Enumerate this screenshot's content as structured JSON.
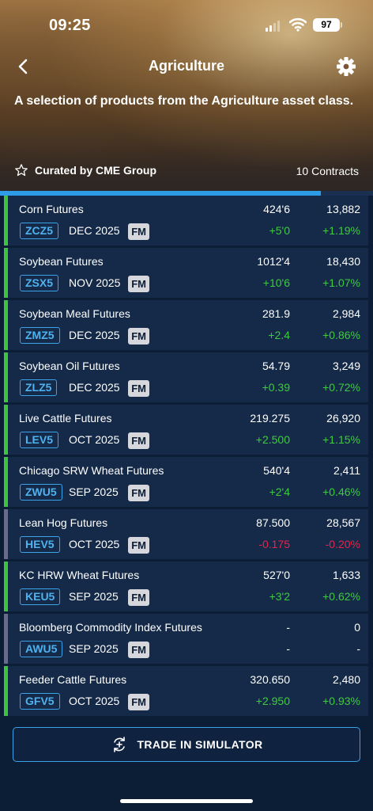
{
  "status_bar": {
    "time": "09:25",
    "battery": "97"
  },
  "header": {
    "title": "Agriculture",
    "subtitle": "A selection of products from the Agriculture asset class.",
    "curated_by": "Curated by CME Group",
    "contracts_count": "10 Contracts",
    "scroll_progress_fraction": 0.86
  },
  "colors": {
    "accent_green": "#3ec43f",
    "accent_grey": "#6b6a8a",
    "up": "#3ecb3c",
    "down": "#e8234a",
    "neutral": "#ffffff",
    "code_blue": "#3aa3e8"
  },
  "contracts": [
    {
      "name": "Corn Futures",
      "code": "ZCZ5",
      "month": "DEC 2025",
      "tag": "FM",
      "price": "424'6",
      "volume": "13,882",
      "change": "+5'0",
      "pct": "+1.19%",
      "direction": "up",
      "accent": "green"
    },
    {
      "name": "Soybean Futures",
      "code": "ZSX5",
      "month": "NOV 2025",
      "tag": "FM",
      "price": "1012'4",
      "volume": "18,430",
      "change": "+10'6",
      "pct": "+1.07%",
      "direction": "up",
      "accent": "green"
    },
    {
      "name": "Soybean Meal Futures",
      "code": "ZMZ5",
      "month": "DEC 2025",
      "tag": "FM",
      "price": "281.9",
      "volume": "2,984",
      "change": "+2.4",
      "pct": "+0.86%",
      "direction": "up",
      "accent": "green"
    },
    {
      "name": "Soybean Oil Futures",
      "code": "ZLZ5",
      "month": "DEC 2025",
      "tag": "FM",
      "price": "54.79",
      "volume": "3,249",
      "change": "+0.39",
      "pct": "+0.72%",
      "direction": "up",
      "accent": "green"
    },
    {
      "name": "Live Cattle Futures",
      "code": "LEV5",
      "month": "OCT 2025",
      "tag": "FM",
      "price": "219.275",
      "volume": "26,920",
      "change": "+2.500",
      "pct": "+1.15%",
      "direction": "up",
      "accent": "green"
    },
    {
      "name": "Chicago SRW Wheat Futures",
      "code": "ZWU5",
      "month": "SEP 2025",
      "tag": "FM",
      "price": "540'4",
      "volume": "2,411",
      "change": "+2'4",
      "pct": "+0.46%",
      "direction": "up",
      "accent": "green"
    },
    {
      "name": "Lean Hog Futures",
      "code": "HEV5",
      "month": "OCT 2025",
      "tag": "FM",
      "price": "87.500",
      "volume": "28,567",
      "change": "-0.175",
      "pct": "-0.20%",
      "direction": "down",
      "accent": "grey"
    },
    {
      "name": "KC HRW Wheat Futures",
      "code": "KEU5",
      "month": "SEP 2025",
      "tag": "FM",
      "price": "527'0",
      "volume": "1,633",
      "change": "+3'2",
      "pct": "+0.62%",
      "direction": "up",
      "accent": "green"
    },
    {
      "name": "Bloomberg Commodity Index Futures",
      "code": "AWU5",
      "month": "SEP 2025",
      "tag": "FM",
      "price": "-",
      "volume": "0",
      "change": "-",
      "pct": "-",
      "direction": "neutral",
      "accent": "grey"
    },
    {
      "name": "Feeder Cattle Futures",
      "code": "GFV5",
      "month": "OCT 2025",
      "tag": "FM",
      "price": "320.650",
      "volume": "2,480",
      "change": "+2.950",
      "pct": "+0.93%",
      "direction": "up",
      "accent": "green"
    }
  ],
  "actions": {
    "trade_button": "TRADE IN SIMULATOR"
  },
  "icons": {
    "back": "chevron-left-icon",
    "settings": "gear-icon",
    "favorite": "star-outline-icon",
    "trade": "exchange-arrows-icon"
  }
}
